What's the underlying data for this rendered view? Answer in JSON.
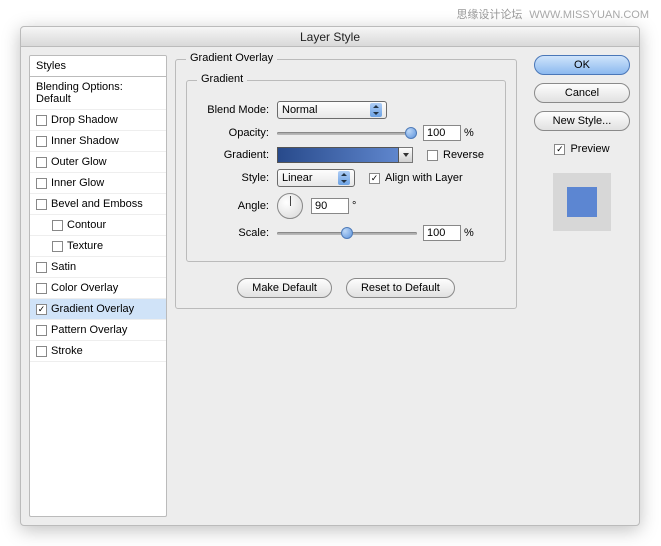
{
  "watermark": {
    "cn": "思缘设计论坛",
    "url": "WWW.MISSYUAN.COM"
  },
  "dialog": {
    "title": "Layer Style"
  },
  "sidebar": {
    "header": "Styles",
    "blending": "Blending Options: Default",
    "items": [
      {
        "label": "Drop Shadow",
        "checked": false
      },
      {
        "label": "Inner Shadow",
        "checked": false
      },
      {
        "label": "Outer Glow",
        "checked": false
      },
      {
        "label": "Inner Glow",
        "checked": false
      },
      {
        "label": "Bevel and Emboss",
        "checked": false
      },
      {
        "label": "Contour",
        "checked": false,
        "indent": true
      },
      {
        "label": "Texture",
        "checked": false,
        "indent": true
      },
      {
        "label": "Satin",
        "checked": false
      },
      {
        "label": "Color Overlay",
        "checked": false
      },
      {
        "label": "Gradient Overlay",
        "checked": true,
        "selected": true
      },
      {
        "label": "Pattern Overlay",
        "checked": false
      },
      {
        "label": "Stroke",
        "checked": false
      }
    ]
  },
  "panel": {
    "group_title": "Gradient Overlay",
    "sub_title": "Gradient",
    "blend_mode_label": "Blend Mode:",
    "blend_mode_value": "Normal",
    "opacity_label": "Opacity:",
    "opacity_value": "100",
    "opacity_unit": "%",
    "gradient_label": "Gradient:",
    "reverse_label": "Reverse",
    "style_label": "Style:",
    "style_value": "Linear",
    "align_label": "Align with Layer",
    "align_checked": true,
    "angle_label": "Angle:",
    "angle_value": "90",
    "angle_unit": "°",
    "scale_label": "Scale:",
    "scale_value": "100",
    "scale_unit": "%",
    "make_default": "Make Default",
    "reset_default": "Reset to Default"
  },
  "buttons": {
    "ok": "OK",
    "cancel": "Cancel",
    "new_style": "New Style...",
    "preview": "Preview"
  }
}
